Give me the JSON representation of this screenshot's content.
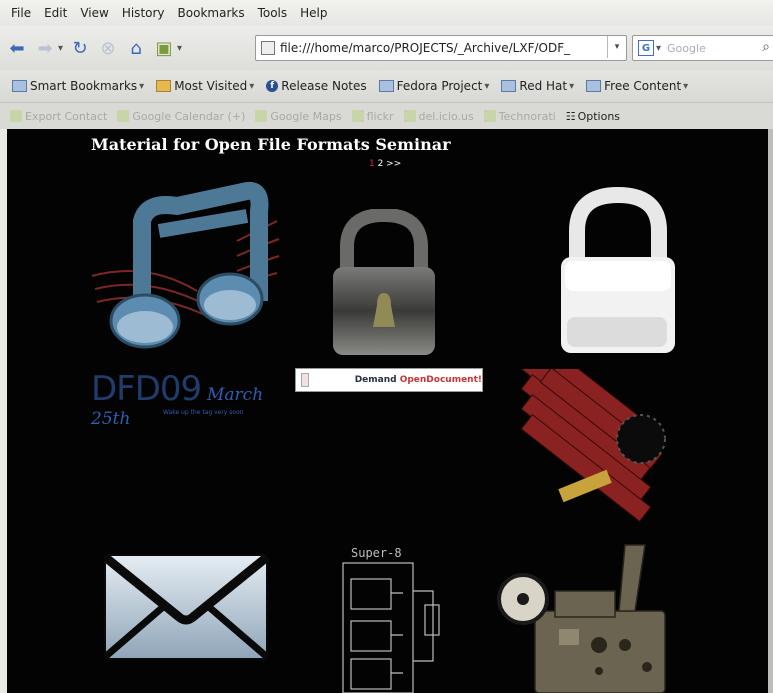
{
  "menubar": {
    "items": [
      "File",
      "Edit",
      "View",
      "History",
      "Bookmarks",
      "Tools",
      "Help"
    ]
  },
  "navbar": {
    "url": "file:///home/marco/PROJECTS/_Archive/LXF/ODF_",
    "search_placeholder": "Google",
    "search_engine_letter": "G"
  },
  "bookmarks": {
    "items": [
      "Smart Bookmarks",
      "Most Visited",
      "Release Notes",
      "Fedora Project",
      "Red Hat",
      "Free Content"
    ]
  },
  "toolbar2": {
    "items": [
      "Export Contact",
      "Google Calendar (+)",
      "Google Maps",
      "flickr",
      "del.icio.us",
      "Technorati"
    ],
    "options_label": "Options"
  },
  "page": {
    "title": "Material for Open File Formats Seminar",
    "pager_current": "1",
    "pager_rest": " 2 >>",
    "dfd_text": "DFD09",
    "dfd_date": "March 25th",
    "dfd_sub": "Wake up the tag very soon",
    "banner_text_a": "Demand ",
    "banner_text_b": "OpenDocument!",
    "schematic_label": "Super-8"
  },
  "colors": {
    "content_bg": "#030303",
    "accent_blue": "#3a69b8"
  }
}
